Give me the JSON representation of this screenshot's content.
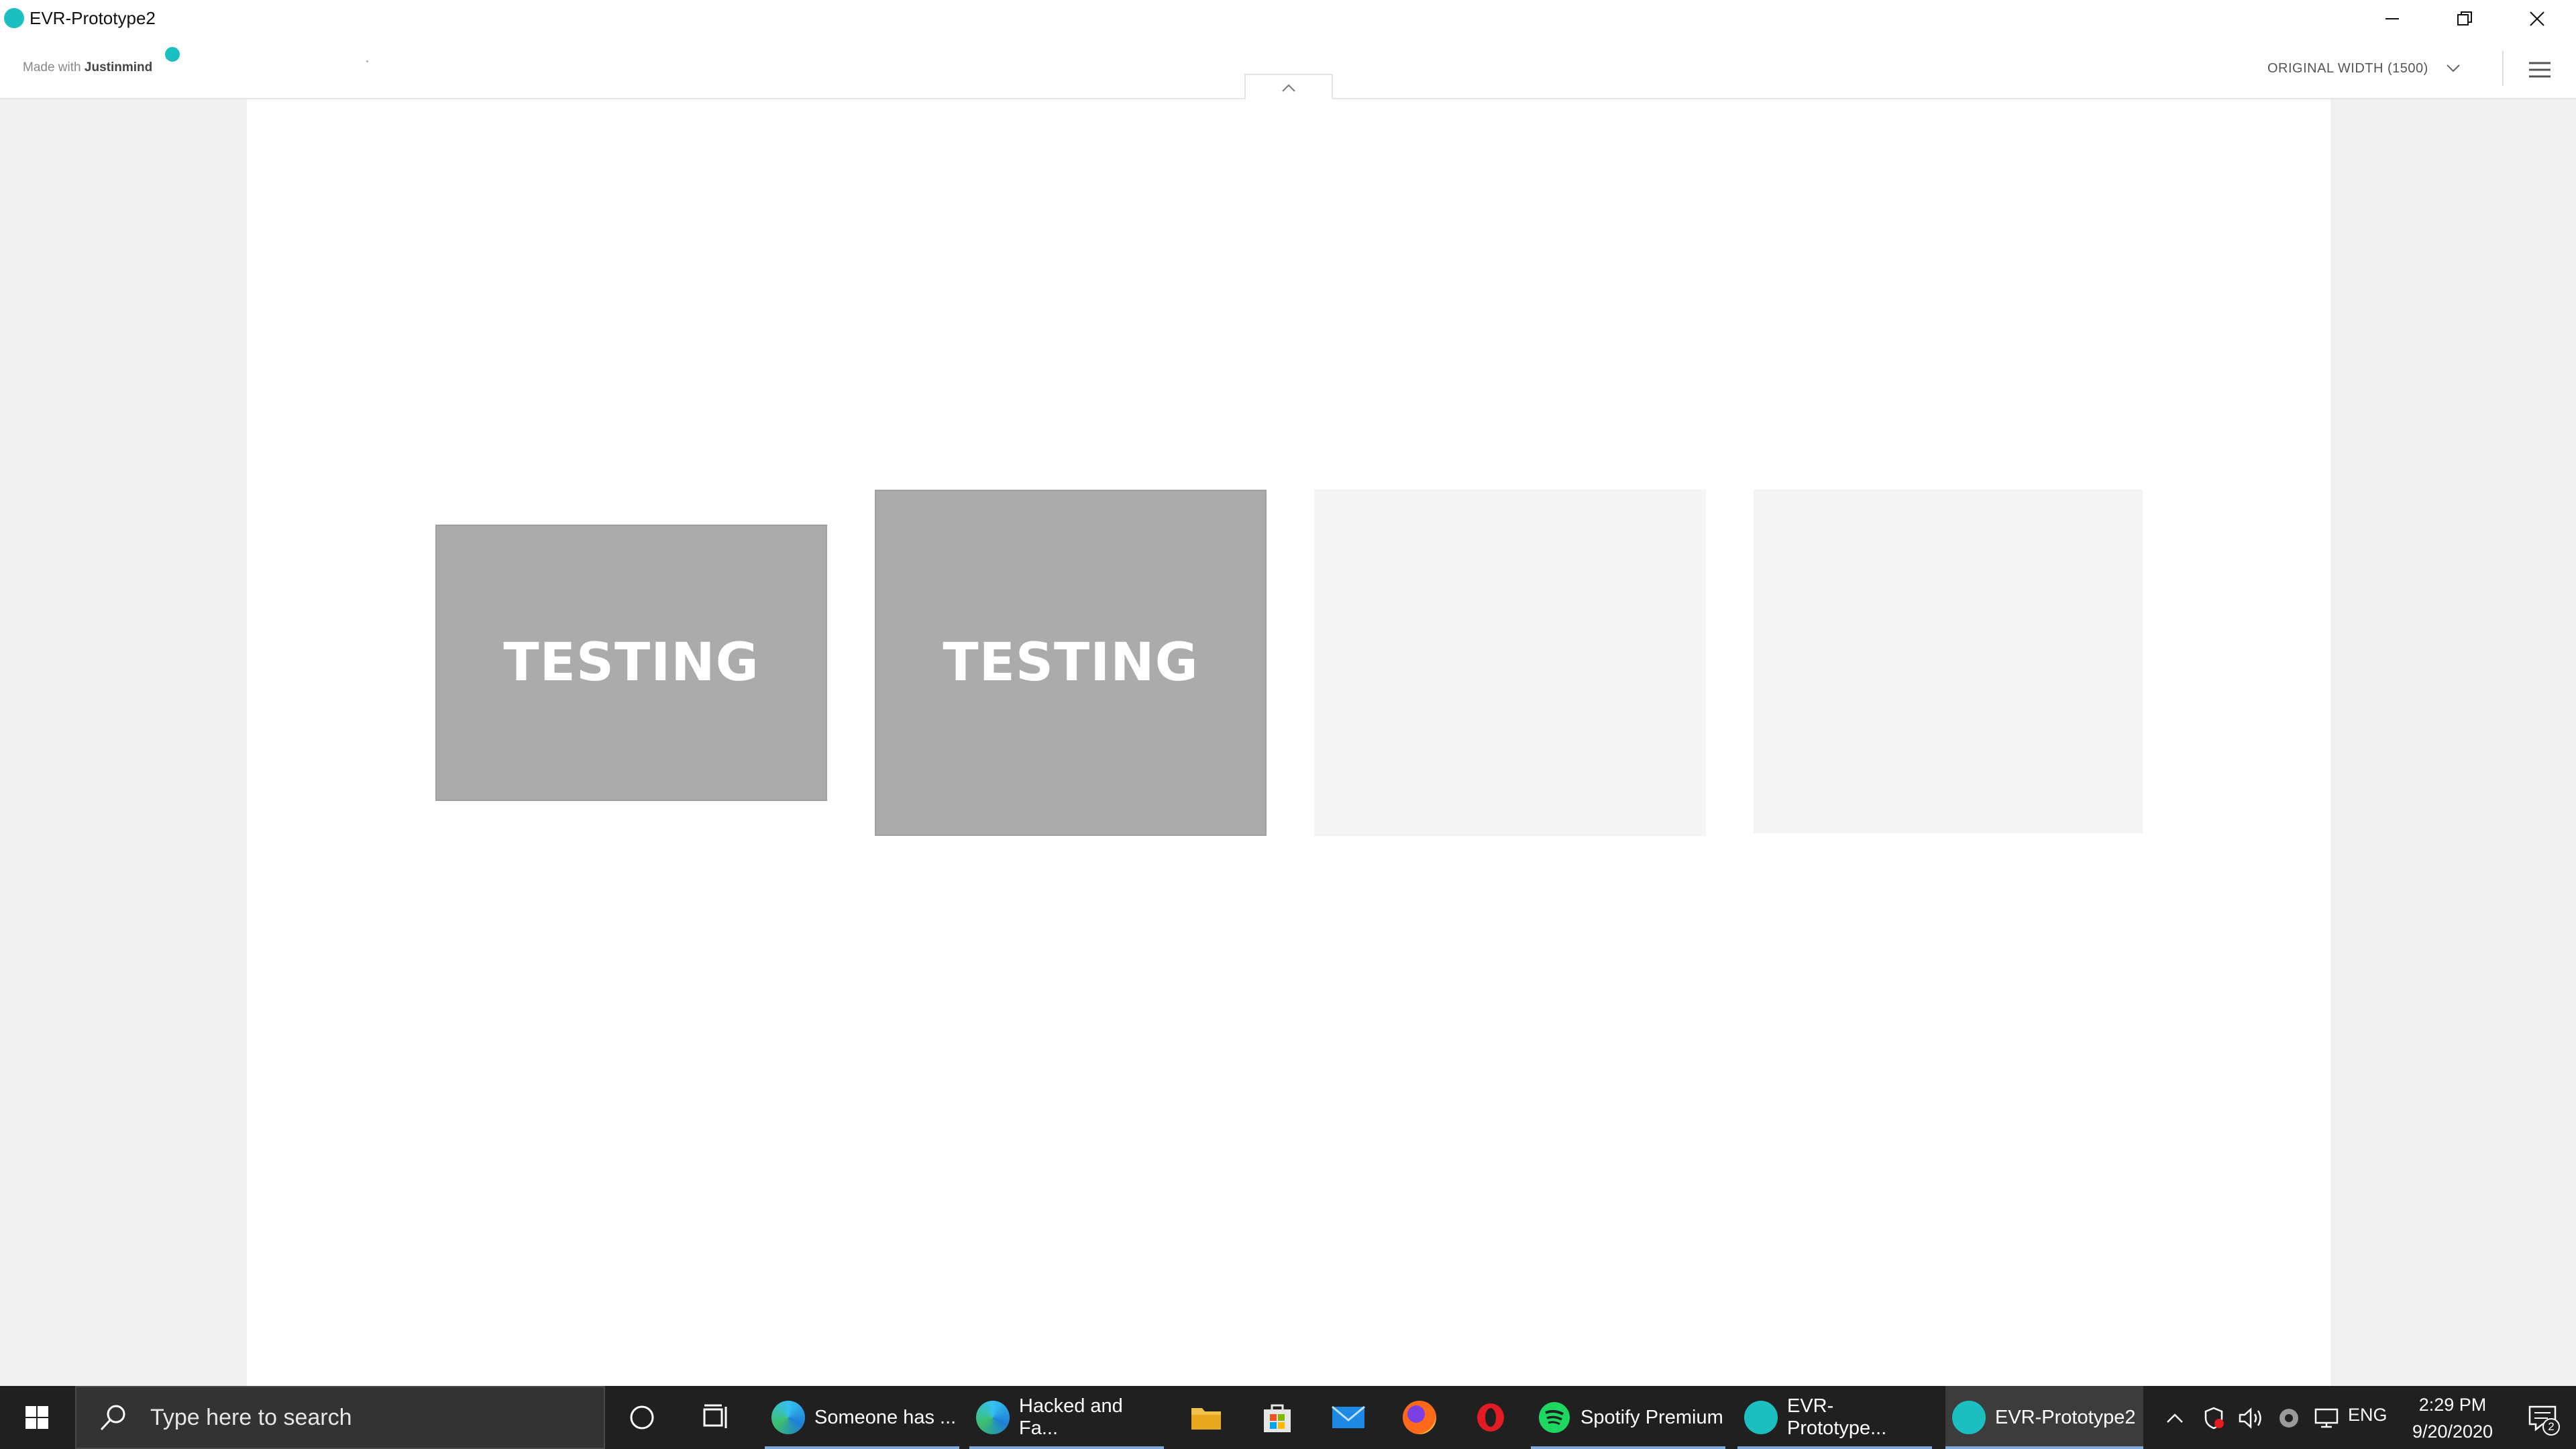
{
  "window": {
    "title": "EVR-Prototype2",
    "buttons": [
      "minimize-icon",
      "restore-icon",
      "close-icon"
    ]
  },
  "toolbar": {
    "made_with_prefix": "Made with",
    "brand": "Justinmind",
    "width_option": "ORIGINAL WIDTH (1500)",
    "menu_icon": "hamburger-icon",
    "collapse_icon": "chevron-up-icon"
  },
  "canvas": {
    "cards": [
      {
        "label": "TESTING",
        "style": "dark"
      },
      {
        "label": "TESTING",
        "style": "dark"
      },
      {
        "label": "",
        "style": "light"
      },
      {
        "label": "",
        "style": "light"
      }
    ]
  },
  "taskbar": {
    "search_placeholder": "Type here to search",
    "apps": [
      {
        "label": "Someone has ...",
        "icon": "edge-icon"
      },
      {
        "label": "Hacked and Fa...",
        "icon": "edge-icon"
      },
      {
        "label": "",
        "icon": "file-explorer-icon"
      },
      {
        "label": "",
        "icon": "store-icon"
      },
      {
        "label": "",
        "icon": "mail-icon"
      },
      {
        "label": "",
        "icon": "firefox-icon"
      },
      {
        "label": "",
        "icon": "opera-icon"
      },
      {
        "label": "Spotify Premium",
        "icon": "spotify-icon"
      },
      {
        "label": "EVR-Prototype...",
        "icon": "justinmind-icon"
      },
      {
        "label": "EVR-Prototype2",
        "icon": "justinmind-icon",
        "active": true
      }
    ],
    "tray": {
      "language": "ENG",
      "time": "2:29 PM",
      "date": "9/20/2020",
      "notification_count": "2"
    }
  },
  "colors": {
    "accent": "#1cbfc0",
    "card_dark": "#ababab",
    "card_light": "#f4f4f4",
    "taskbar": "#202020"
  }
}
